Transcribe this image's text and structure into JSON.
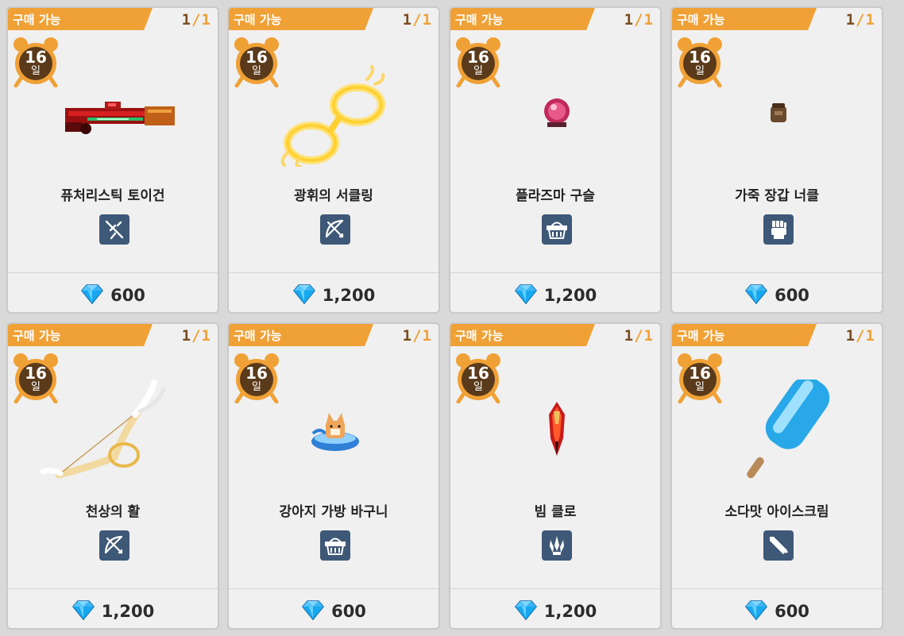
{
  "cards": [
    {
      "status": "구매 가능",
      "limit_current": "1",
      "limit_sep": "/",
      "limit_max": "1",
      "days": "16",
      "days_unit": "일",
      "name": "퓨처리스틱 토이건",
      "type_icon": "gun-icon",
      "image": "red-futuristic-toy-gun",
      "price": "600",
      "currency_icon": "blue-gem-icon"
    },
    {
      "status": "구매 가능",
      "limit_current": "1",
      "limit_sep": "/",
      "limit_max": "1",
      "days": "16",
      "days_unit": "일",
      "name": "광휘의 서클링",
      "type_icon": "bow-icon",
      "image": "golden-radiant-circle-ring",
      "price": "1,200",
      "currency_icon": "blue-gem-icon"
    },
    {
      "status": "구매 가능",
      "limit_current": "1",
      "limit_sep": "/",
      "limit_max": "1",
      "days": "16",
      "days_unit": "일",
      "name": "플라즈마 구슬",
      "type_icon": "basket-icon",
      "image": "plasma-orb",
      "price": "1,200",
      "currency_icon": "blue-gem-icon"
    },
    {
      "status": "구매 가능",
      "limit_current": "1",
      "limit_sep": "/",
      "limit_max": "1",
      "days": "16",
      "days_unit": "일",
      "name": "가죽 장갑 너클",
      "type_icon": "fist-icon",
      "image": "leather-glove-knuckle",
      "price": "600",
      "currency_icon": "blue-gem-icon"
    },
    {
      "status": "구매 가능",
      "limit_current": "1",
      "limit_sep": "/",
      "limit_max": "1",
      "days": "16",
      "days_unit": "일",
      "name": "천상의 활",
      "type_icon": "bow-icon",
      "image": "celestial-winged-bow",
      "price": "1,200",
      "currency_icon": "blue-gem-icon"
    },
    {
      "status": "구매 가능",
      "limit_current": "1",
      "limit_sep": "/",
      "limit_max": "1",
      "days": "16",
      "days_unit": "일",
      "name": "강아지 가방 바구니",
      "type_icon": "basket-icon",
      "image": "puppy-in-blue-basket",
      "price": "600",
      "currency_icon": "blue-gem-icon"
    },
    {
      "status": "구매 가능",
      "limit_current": "1",
      "limit_sep": "/",
      "limit_max": "1",
      "days": "16",
      "days_unit": "일",
      "name": "빔 클로",
      "type_icon": "claw-icon",
      "image": "beam-claw",
      "price": "1,200",
      "currency_icon": "blue-gem-icon"
    },
    {
      "status": "구매 가능",
      "limit_current": "1",
      "limit_sep": "/",
      "limit_max": "1",
      "days": "16",
      "days_unit": "일",
      "name": "소다맛 아이스크림",
      "type_icon": "sword-icon",
      "image": "soda-popsicle",
      "price": "600",
      "currency_icon": "blue-gem-icon"
    }
  ],
  "colors": {
    "banner": "#f0a136",
    "limit_current": "#7a4d1f",
    "timer_face": "#5a3a1a",
    "timer_ring": "#f0a136",
    "badge": "#3e5877",
    "gem": "#1e9be6"
  }
}
